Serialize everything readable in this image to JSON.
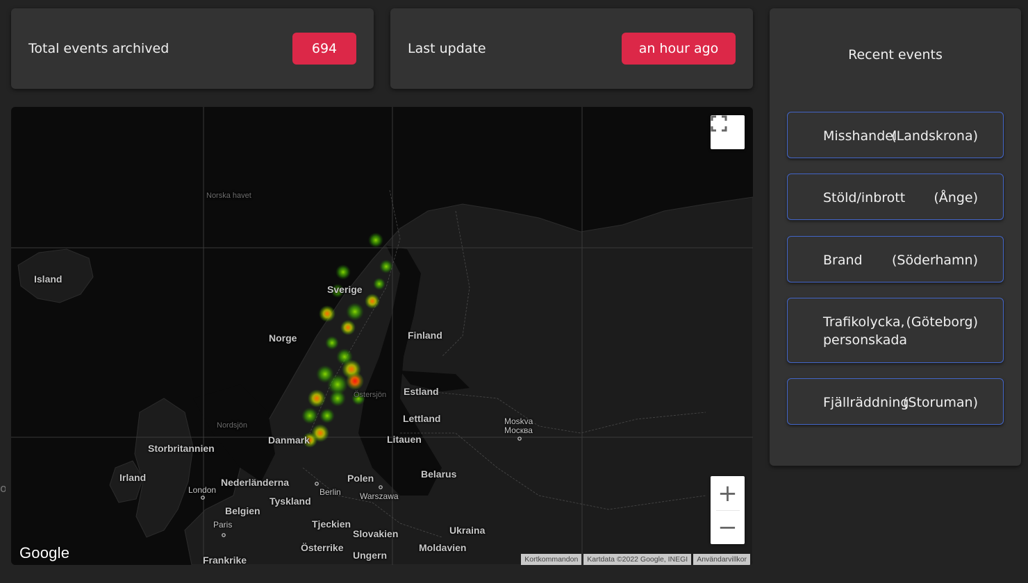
{
  "stats": {
    "total_label": "Total events archived",
    "total_value": "694",
    "update_label": "Last update",
    "update_value": "an hour ago",
    "badge_color": "#dc2848"
  },
  "map": {
    "labels": {
      "island": "Island",
      "norska_havet": "Norska havet",
      "sverige": "Sverige",
      "norge": "Norge",
      "finland": "Finland",
      "estland": "Estland",
      "ostersjon": "Östersjön",
      "lettland": "Lettland",
      "moskva": "Moskva",
      "moskva_cyr": "Москва",
      "nordsjon": "Nordsjön",
      "danmark": "Danmark",
      "litauen": "Litauen",
      "storbritannien": "Storbritannien",
      "irland": "Irland",
      "nederlanderna": "Nederländerna",
      "polen": "Polen",
      "belarus": "Belarus",
      "london": "London",
      "berlin": "Berlin",
      "warszawa": "Warszawa",
      "tyskland": "Tyskland",
      "belgien": "Belgien",
      "paris": "Paris",
      "tjeckien": "Tjeckien",
      "slovakien": "Slovakien",
      "ukraina": "Ukraina",
      "osterrike": "Österrike",
      "ungern": "Ungern",
      "moldavien": "Moldavien",
      "frankrike": "Frankrike"
    },
    "google_logo": "Google",
    "attribution": [
      "Kortkommandon",
      "Kartdata ©2022 Google, INEGI",
      "Användarvillkor"
    ],
    "zoom_in_label": "+",
    "zoom_out_label": "−",
    "fullscreen_icon": "fullscreen-icon"
  },
  "recent": {
    "title": "Recent events",
    "border_color": "#4366c9",
    "events": [
      {
        "type": "Misshandel",
        "place": "(Landskrona)"
      },
      {
        "type": "Stöld/inbrott",
        "place": "(Ånge)"
      },
      {
        "type": "Brand",
        "place": "(Söderhamn)"
      },
      {
        "type": "Trafikolycka, personskada",
        "place": "(Göteborg)"
      },
      {
        "type": "Fjällräddning",
        "place": "(Storuman)"
      }
    ]
  },
  "side_artifact": "oc"
}
